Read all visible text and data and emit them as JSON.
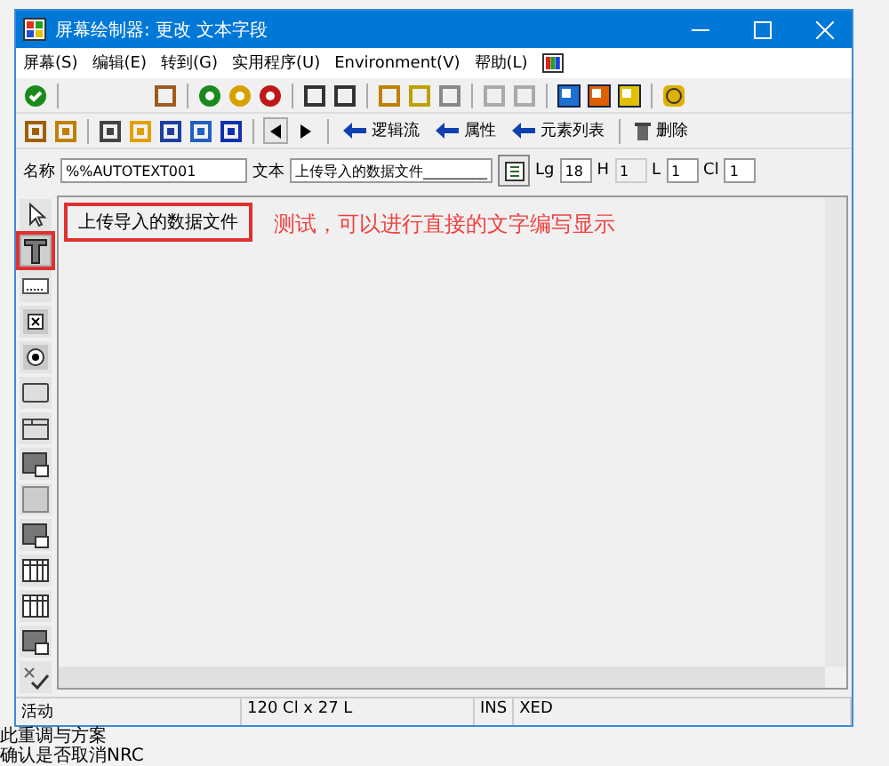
{
  "window": {
    "title": "屏幕绘制器:  更改 文本字段"
  },
  "menu": [
    "屏幕(S)",
    "编辑(E)",
    "转到(G)",
    "实用程序(U)",
    "Environment(V)",
    "帮助(L)"
  ],
  "toolbar2": [
    {
      "kind": "arrow",
      "label": "逻辑流"
    },
    {
      "kind": "arrow",
      "label": "属性"
    },
    {
      "kind": "arrow",
      "label": "元素列表"
    },
    {
      "kind": "trash",
      "label": "删除"
    }
  ],
  "form": [
    {
      "label": "名称",
      "value": "%%AUTOTEXT001",
      "kind": "wide"
    },
    {
      "label": "文本",
      "value": "上传导入的数据文件_________",
      "kind": "wide"
    },
    {
      "label": "Lg",
      "value": "18",
      "kind": "small",
      "disabled": false
    },
    {
      "label": "H",
      "value": "1",
      "kind": "small",
      "disabled": true
    },
    {
      "label": "L",
      "value": "1",
      "kind": "small",
      "disabled": false
    },
    {
      "label": "Cl",
      "value": "1",
      "kind": "small",
      "disabled": false
    }
  ],
  "palette": [
    {
      "kind": "pointer",
      "selected": false
    },
    {
      "kind": "text",
      "selected": true
    },
    {
      "kind": "input",
      "selected": false
    },
    {
      "kind": "crossbox",
      "selected": false
    },
    {
      "kind": "dotcircle",
      "selected": false
    },
    {
      "kind": "button",
      "selected": false
    },
    {
      "kind": "tabstrip",
      "selected": false
    },
    {
      "kind": "subscreen",
      "selected": false
    },
    {
      "kind": "box",
      "selected": false
    },
    {
      "kind": "subscreen2",
      "selected": false
    },
    {
      "kind": "table",
      "selected": false
    },
    {
      "kind": "table2",
      "selected": false
    },
    {
      "kind": "custom",
      "selected": false
    },
    {
      "kind": "status",
      "selected": false
    }
  ],
  "canvas": {
    "element": "上传导入的数据文件",
    "annotation": "测试，可以进行直接的文字编写显示"
  },
  "status_bar": [
    "活动",
    "120 Cl x 27 L",
    "INS",
    "XED"
  ],
  "background_lines": [
    "此重调与方案",
    "确认是否取消NRC"
  ]
}
